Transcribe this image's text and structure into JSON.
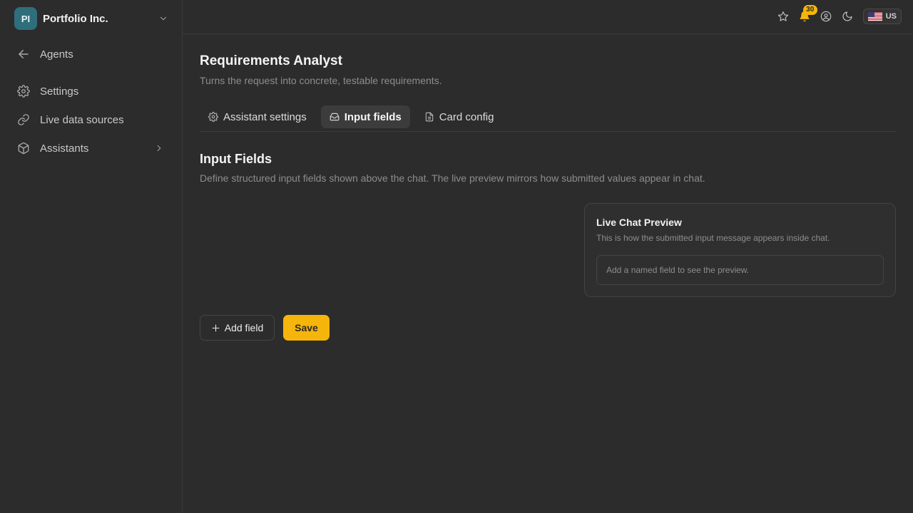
{
  "sidebar": {
    "org": {
      "initials": "PI",
      "name": "Portfolio Inc.",
      "avatar_color": "#2f6f7c"
    },
    "items": [
      {
        "label": "Agents",
        "icon": "arrow-left-icon"
      },
      {
        "label": "Settings",
        "icon": "gear-icon"
      },
      {
        "label": "Live data sources",
        "icon": "link-icon"
      },
      {
        "label": "Assistants",
        "icon": "cube-icon"
      }
    ]
  },
  "topbar": {
    "notification_count": "30",
    "locale": "US",
    "icons": [
      "star-icon",
      "bell-icon",
      "user-circle-icon",
      "moon-icon",
      "us-flag-icon"
    ]
  },
  "page": {
    "title": "Requirements Analyst",
    "subtitle": "Turns the request into concrete, testable requirements."
  },
  "tabs": [
    {
      "label": "Assistant settings",
      "icon": "gear-icon",
      "active": false
    },
    {
      "label": "Input fields",
      "icon": "tray-icon",
      "active": true
    },
    {
      "label": "Card config",
      "icon": "file-icon",
      "active": false
    }
  ],
  "section": {
    "title": "Input Fields",
    "subtitle": "Define structured input fields shown above the chat. The live preview mirrors how submitted values appear in chat."
  },
  "preview": {
    "title": "Live Chat Preview",
    "subtitle": "This is how the submitted input message appears inside chat.",
    "placeholder": "Add a named field to see the preview."
  },
  "actions": {
    "add_field_label": "Add field",
    "save_label": "Save"
  },
  "colors": {
    "accent": "#f5b50a",
    "background": "#2c2c2c"
  }
}
